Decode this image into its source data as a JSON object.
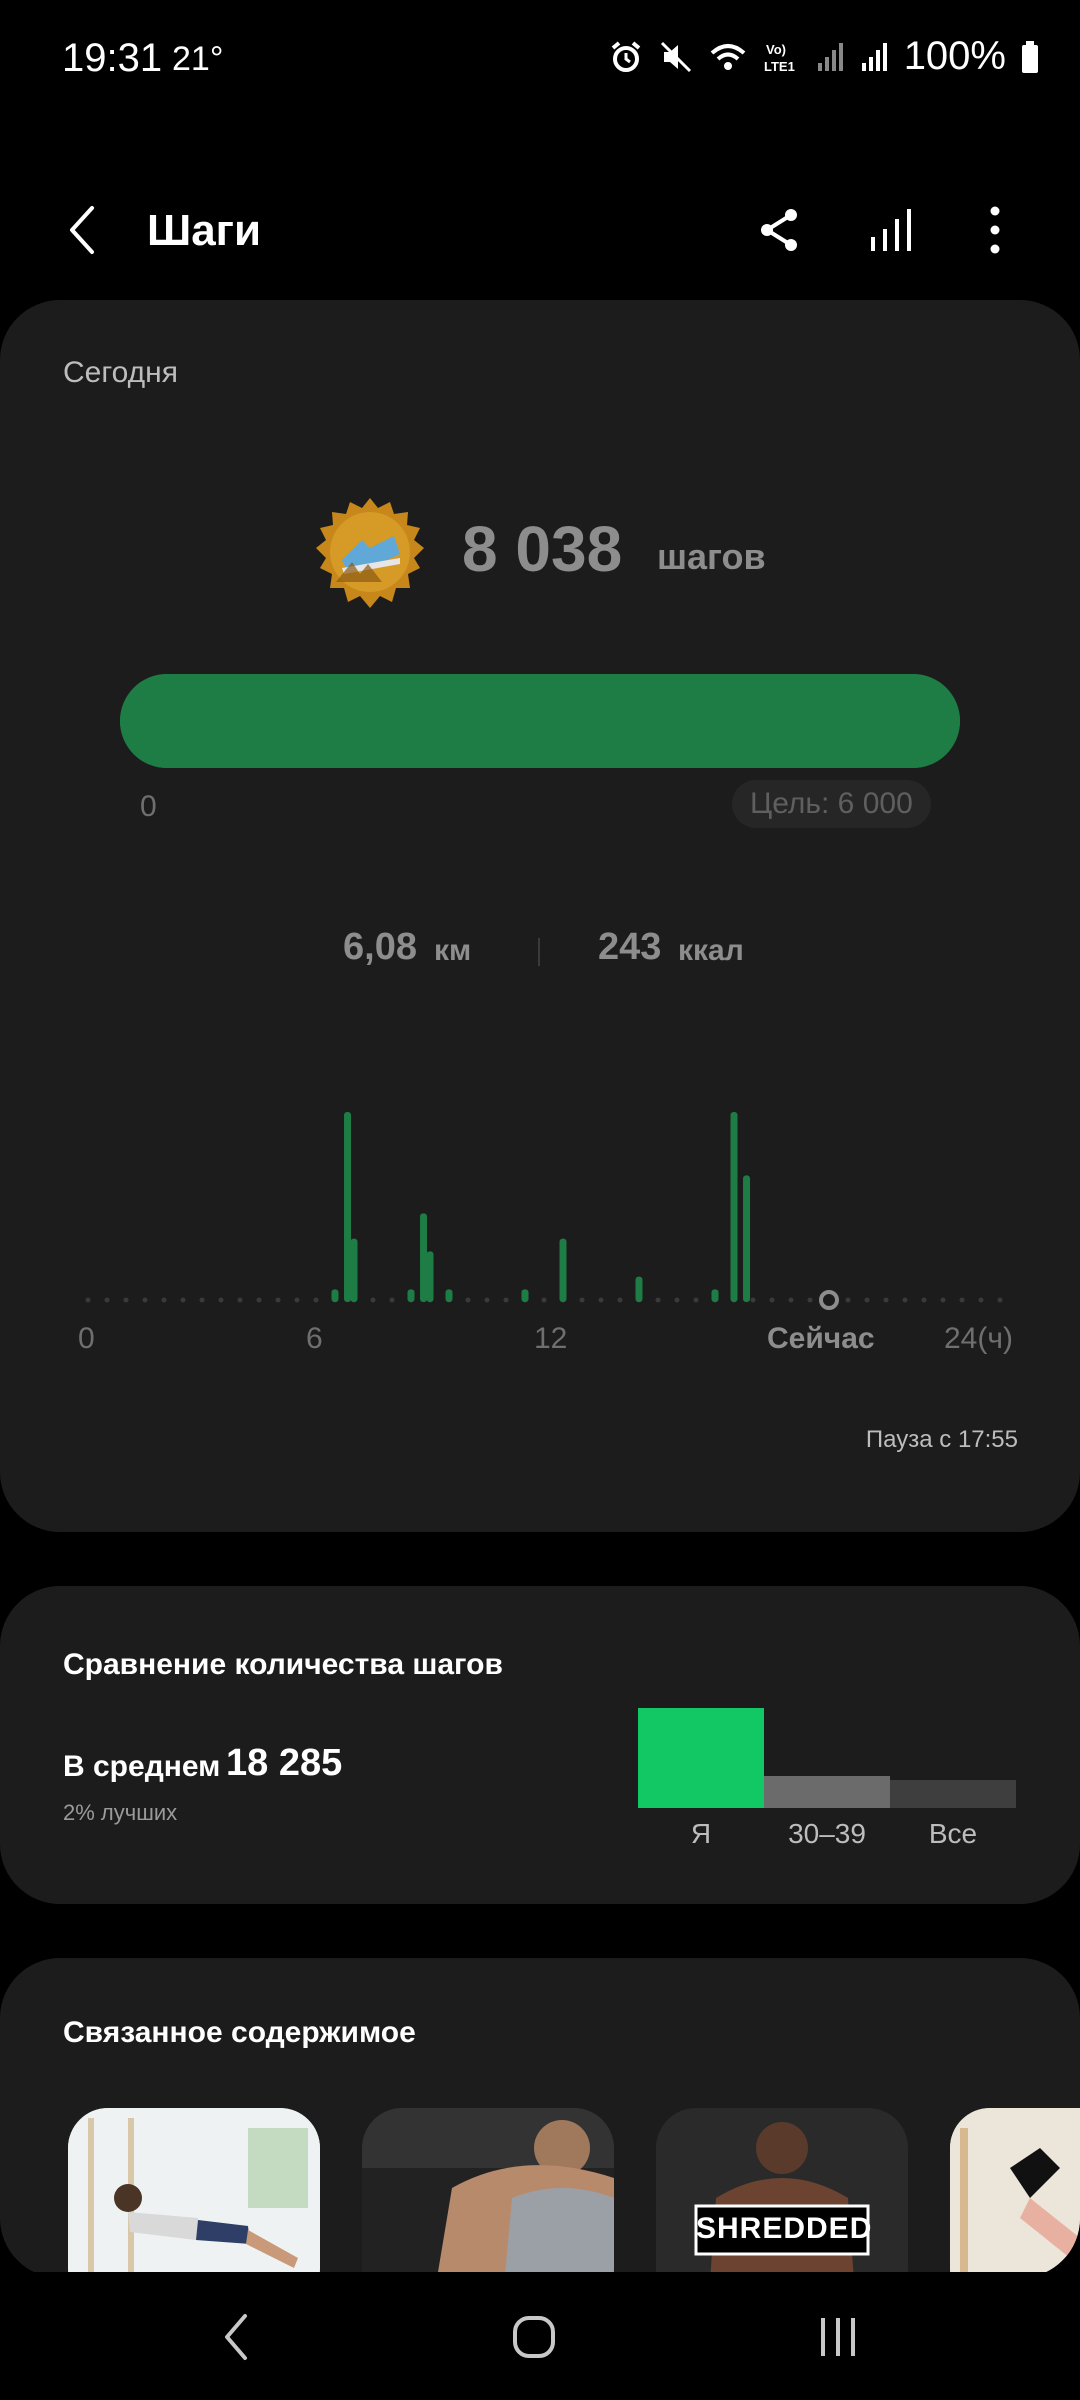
{
  "status_bar": {
    "time": "19:31",
    "temperature": "21°",
    "battery": "100%",
    "icons": [
      "alarm-icon",
      "mute-icon",
      "wifi-icon",
      "volte-lte-icon",
      "signal-icon",
      "signal-icon",
      "battery-icon"
    ]
  },
  "header": {
    "title": "Шаги",
    "icons": [
      "back-icon",
      "share-icon",
      "bar-chart-icon",
      "more-icon"
    ]
  },
  "today": {
    "label": "Сегодня",
    "steps_value": "8 038",
    "steps_unit": "шагов",
    "progress_fraction": 1.0,
    "progress_start": "0",
    "goal": "Цель: 6 000",
    "distance_value": "6,08",
    "distance_unit": "км",
    "calories_value": "243",
    "calories_unit": "ккал",
    "pause_text": "Пауза с 17:55"
  },
  "chart_data": {
    "type": "bar",
    "x": [
      6.5,
      6.83,
      7.0,
      8.5,
      8.83,
      9.0,
      9.5,
      11.5,
      12.5,
      14.5,
      16.5,
      17.0,
      17.33
    ],
    "values": [
      1,
      15,
      5,
      1,
      7,
      4,
      1,
      1,
      5,
      2,
      1,
      15,
      10
    ],
    "x_ticks": [
      "0",
      "6",
      "12",
      "Сейчас",
      "24(ч)"
    ],
    "x_tick_values": [
      0,
      6,
      12,
      19.5,
      24
    ],
    "xlim": [
      0,
      24
    ],
    "now_hour": 19.5,
    "color": "#1e7d45"
  },
  "compare": {
    "title": "Сравнение количества шагов",
    "avg_label": "В среднем",
    "avg_value": "18 285",
    "top_percent": "2% лучших",
    "bars": [
      {
        "label": "Я",
        "level": 1.0,
        "color": "#12c865"
      },
      {
        "label": "30–39",
        "level": 0.32,
        "color": "#6b6b6b"
      },
      {
        "label": "Все",
        "level": 0.28,
        "color": "#3e3e3e"
      }
    ]
  },
  "related": {
    "title": "Связанное содержимое",
    "thumbnails": [
      {
        "name": "workout-thumbnail-1",
        "caption": ""
      },
      {
        "name": "workout-thumbnail-2",
        "caption": ""
      },
      {
        "name": "workout-thumbnail-3",
        "caption": "SHREDDED"
      },
      {
        "name": "workout-thumbnail-4",
        "caption": ""
      }
    ]
  },
  "navbar": {
    "icons": [
      "nav-back-icon",
      "nav-home-icon",
      "nav-recents-icon"
    ]
  }
}
